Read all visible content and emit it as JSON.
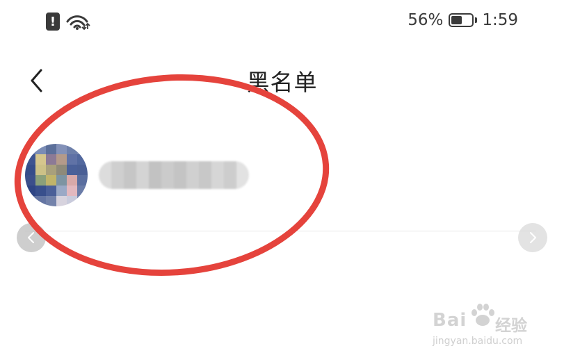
{
  "status_bar": {
    "battery_text": "56%",
    "battery_level": 0.56,
    "time": "1:59",
    "icons": [
      "alert-icon",
      "wifi-icon",
      "battery-icon"
    ]
  },
  "header": {
    "title": "黑名单",
    "back_icon": "chevron-left-icon"
  },
  "blacklist": {
    "items": [
      {
        "avatar": "pixelated-avatar",
        "name_obscured": true
      }
    ]
  },
  "carousel": {
    "prev_icon": "chevron-left-icon",
    "next_icon": "chevron-right-icon"
  },
  "annotation": {
    "shape": "ellipse",
    "color": "#e5433c"
  },
  "watermark": {
    "brand": "Bai",
    "suffix": "经验",
    "url": "jingyan.baidu.com"
  },
  "colors": {
    "text": "#222222",
    "status_text": "#3a3a3a",
    "divider": "#e6e6e6",
    "annotation_red": "#e5433c"
  }
}
